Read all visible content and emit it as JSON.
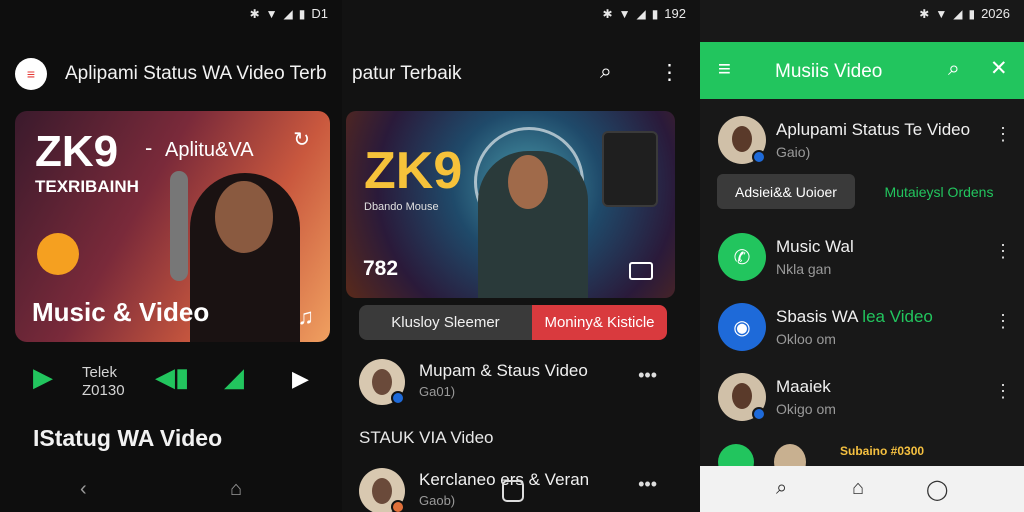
{
  "screen1": {
    "status_time": "D1",
    "logo_icon": "menu-lines-icon",
    "title": "Aplipami Status WA Video Terb",
    "card": {
      "headline": "ZK9",
      "dash": "-",
      "subtitle": "Aplitu&VA",
      "subtitle2": "TEXRIBAINH",
      "caption": "Music & Video"
    },
    "controls": {
      "tele_line1": "Telek",
      "tele_line2": "Z0130"
    },
    "section_title": "IStatug WA Video"
  },
  "screen2": {
    "status_time": "192",
    "title": "patur Terbaik",
    "card": {
      "headline": "ZK9",
      "caption": "Dbando Mouse",
      "number": "782"
    },
    "segments": [
      "Klusloy Sleemer",
      "Moniny& Kisticle"
    ],
    "rows": [
      {
        "title": "Mupam & Staus Video",
        "subtitle": "Ga01)"
      },
      {
        "title": "Kerclaneo ers & Veran",
        "subtitle": "Gaob)"
      }
    ],
    "section": "STAUK VIA Video"
  },
  "screen3": {
    "status_time": "2026",
    "appbar_title": "Musiis Video",
    "accent": "#22c55e",
    "top_row": {
      "title": "Aplupami Status Te Video",
      "subtitle": "Gaio)"
    },
    "chips": [
      "Adsiei&& Uoioer",
      "Mutaieysl Ordens"
    ],
    "rows": [
      {
        "title": "Music Wal",
        "title_green": "",
        "subtitle": "Nkla gan",
        "icon": "whatsapp-icon"
      },
      {
        "title": "Sbasis WA ",
        "title_green": "lea Video",
        "subtitle": "Okloo om",
        "icon": "chat-bubble-icon"
      },
      {
        "title": "Maaiek",
        "title_green": "",
        "subtitle": "Okigo om",
        "icon": "avatar"
      }
    ],
    "promo_text": "Subaino #0300"
  }
}
